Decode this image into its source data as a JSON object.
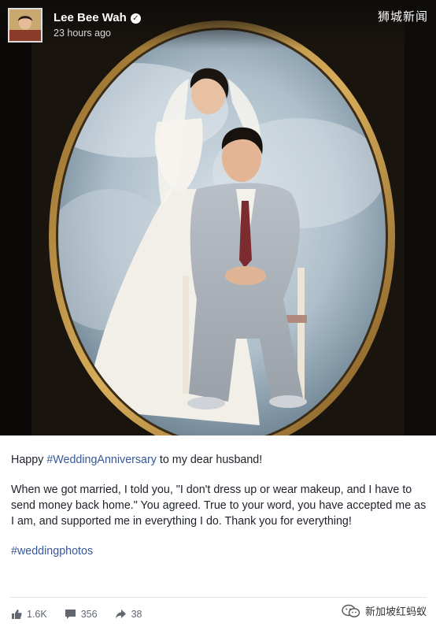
{
  "post": {
    "author": "Lee Bee Wah",
    "timestamp": "23 hours ago",
    "watermark_top": "狮城新闻",
    "text": {
      "line1_before": "Happy ",
      "line1_tag": "#WeddingAnniversary",
      "line1_after": " to my dear husband!",
      "paragraph2": "When we got married, I told you, \"I don't dress up or wear makeup, and I have to send money back home.\" You agreed. True to your word, you have accepted me as I am, and supported me in everything I do. Thank you for everything!",
      "hashtag": "#weddingphotos"
    },
    "stats": {
      "likes": "1.6K",
      "comments": "356",
      "shares": "38"
    },
    "watermark_bottom": "新加坡红蚂蚁",
    "icons": {
      "verified": "verified-badge-icon",
      "like": "thumbs-up-icon",
      "comment": "comment-bubble-icon",
      "share": "share-arrow-icon",
      "wechat": "wechat-logo-icon"
    }
  }
}
